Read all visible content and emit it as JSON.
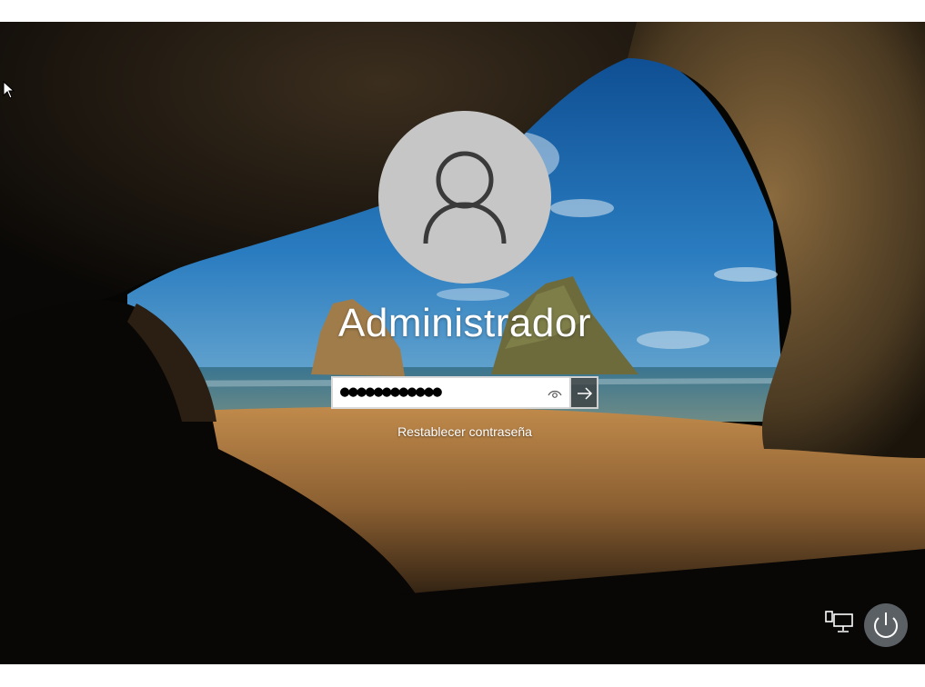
{
  "login": {
    "username": "Administrador",
    "password_masked": "●●●●●●●●●●●●",
    "reset_password_label": "Restablecer contraseña"
  },
  "icons": {
    "avatar": "user-silhouette-icon",
    "reveal_password": "eye-icon",
    "submit": "arrow-right-icon",
    "network": "network-icon",
    "power": "power-icon",
    "cursor": "mouse-pointer-icon"
  },
  "colors": {
    "avatar_bg": "#c6c6c6",
    "text": "#ffffff",
    "sky": "#1e6fb6",
    "sea": "#2a5f78",
    "sand": "#a9773d"
  }
}
